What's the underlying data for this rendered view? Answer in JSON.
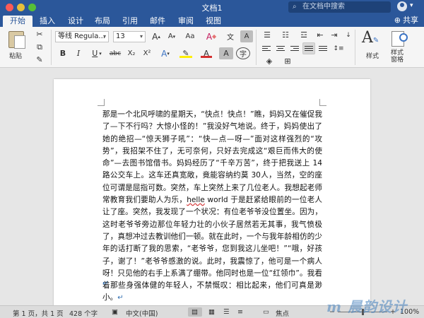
{
  "window": {
    "title": "文档1",
    "search_placeholder": "在文档中搜索"
  },
  "tabs": [
    {
      "label": "开始",
      "active": true
    },
    {
      "label": "插入"
    },
    {
      "label": "设计"
    },
    {
      "label": "布局"
    },
    {
      "label": "引用"
    },
    {
      "label": "邮件"
    },
    {
      "label": "审阅"
    },
    {
      "label": "视图"
    }
  ],
  "share_label": "共享",
  "ribbon": {
    "paste_label": "粘贴",
    "font_name": "等线 Regula...",
    "font_size": "13",
    "bold": "B",
    "italic": "I",
    "underline": "U",
    "strike": "abc",
    "subscript": "X₂",
    "superscript": "X²",
    "grow": "A",
    "shrink": "A",
    "case": "Aa",
    "text_effect": "A",
    "highlight": "ab",
    "font_color": "A",
    "char_shade": "A",
    "phonetic": "字",
    "styles_label": "样式",
    "styles_pane_label": "样式\n窗格",
    "colors": {
      "accent": "#2b579a",
      "font_red": "#d32f2f",
      "highlight_yellow": "#ffef00"
    }
  },
  "document": {
    "paragraph_start": "那是一个北风呼啸的星期天，“快点！快点！”瞧，妈妈又在催促我了—下不行吗？大惊小怪的！”我没好气地说。终于，妈妈使出了她的绝招—“惊天狮子吼”：“快—点—呀—”面对这样强烈的“攻势”，我招架不住了，无可奈何，只好去完成这“艰巨而伟大的使命”—去图书馆借书。妈妈经历了“千辛万苦”，终于把我送上 14 路公交车上。这车还真宽敞，竟能容纳约莫 30人，当然，空的座位可谓是屈指可数。突然，车上突然上来了几位老人。我想起老师常教育我们要助人为乐，",
    "spell_word": "helle",
    "paragraph_end": " world 于是赶紧给眼前的一位老人让了座。突然，我发现了一个状况：有位老爷爷没位置坐。因为，这时老爷爷旁边那位年轻力壮的小伙子居然若无其事，我气愤极了，真想冲过去教训他们一顿。就在此时，一个与我年龄相仿的少年的话打断了我的思索，“老爷爷，您到我这儿坐吧！”“哦，好孩子，谢了！”老爷爷感激的说。此时，我震惊了，他可是一个病人呀！只见他的右手上系满了绷带。他同时也是一位“红领巾”。我看着那些身强体健的年轻人，不禁慨叹：相比起来，他们可真是渺小。",
    "para_mark": "↵"
  },
  "status": {
    "page": "第 1 页，共 1 页",
    "words": "428 个字",
    "language": "中文(中国)",
    "focus": "焦点",
    "zoom": "100%"
  },
  "watermark": "m 晨韵设计网"
}
